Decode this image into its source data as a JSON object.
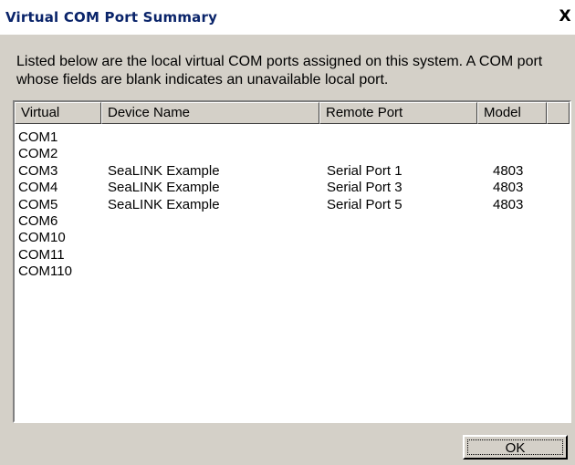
{
  "window": {
    "title": "Virtual COM Port Summary",
    "close_glyph": "X"
  },
  "description": "Listed below are the local virtual COM ports assigned on this system.  A COM port whose fields are blank indicates an unavailable local port.",
  "table": {
    "columns": [
      "Virtual",
      "Device Name",
      "Remote Port",
      "Model"
    ],
    "rows": [
      {
        "virtual": "COM1",
        "device": "",
        "remote": "",
        "model": ""
      },
      {
        "virtual": "COM2",
        "device": "",
        "remote": "",
        "model": ""
      },
      {
        "virtual": "COM3",
        "device": "SeaLINK Example",
        "remote": "Serial Port 1",
        "model": "4803"
      },
      {
        "virtual": "COM4",
        "device": "SeaLINK Example",
        "remote": "Serial Port 3",
        "model": "4803"
      },
      {
        "virtual": "COM5",
        "device": "SeaLINK Example",
        "remote": "Serial Port 5",
        "model": "4803"
      },
      {
        "virtual": "COM6",
        "device": "",
        "remote": "",
        "model": ""
      },
      {
        "virtual": "COM10",
        "device": "",
        "remote": "",
        "model": ""
      },
      {
        "virtual": "COM11",
        "device": "",
        "remote": "",
        "model": ""
      },
      {
        "virtual": "COM110",
        "device": "",
        "remote": "",
        "model": ""
      }
    ]
  },
  "buttons": {
    "ok_label": "OK"
  }
}
